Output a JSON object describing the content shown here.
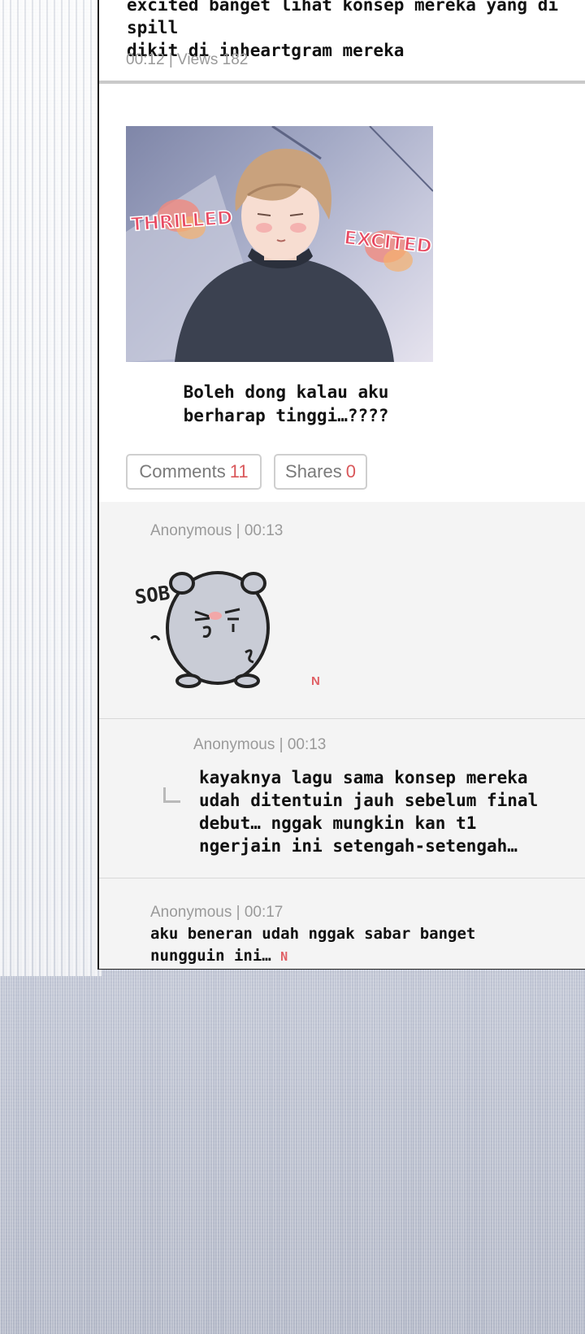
{
  "post": {
    "text_line1": "excited banget lihat konsep mereka yang di spill",
    "text_line2": "dikit di inheartgram mereka",
    "meta": "00:12 | Views 182",
    "image_labels": {
      "left": "THRILLED",
      "right": "EXCITED"
    },
    "caption_line1": "Boleh dong kalau aku",
    "caption_line2": "berharap tinggi…????"
  },
  "actions": {
    "comments_label": "Comments",
    "comments_count": "11",
    "shares_label": "Shares",
    "shares_count": "0"
  },
  "comments": [
    {
      "meta": "Anonymous | 00:13",
      "sticker_text": "SOB",
      "badge": "N"
    },
    {
      "meta": "Anonymous | 00:13",
      "line1": "kayaknya lagu sama konsep mereka",
      "line2": "udah ditentuin jauh sebelum final",
      "line3": "debut… nggak mungkin kan t1",
      "line4": "ngerjain ini setengah-setengah…"
    },
    {
      "meta": "Anonymous | 00:17",
      "line1": "aku beneran udah nggak sabar banget",
      "line2": "nungguin ini…",
      "badge": "N"
    }
  ],
  "colors": {
    "accent": "#d9575a",
    "border": "#1e1e1e",
    "comment_bg": "#f4f4f4"
  }
}
